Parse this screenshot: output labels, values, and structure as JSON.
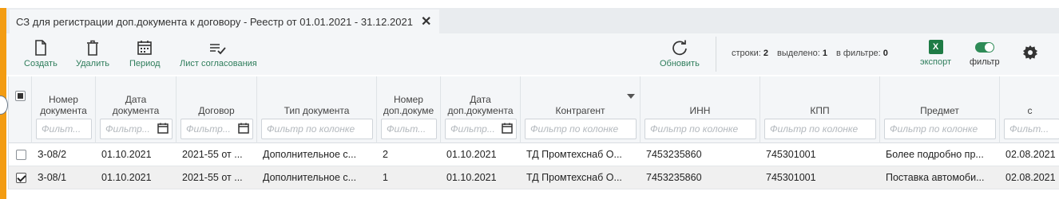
{
  "tab": {
    "title": "СЗ для регистрации доп.документа к договору - Реестр от 01.01.2021 - 31.12.2021"
  },
  "toolbar": {
    "create": "Создать",
    "delete": "Удалить",
    "period": "Период",
    "approval_sheet": "Лист согласования",
    "refresh": "Обновить",
    "export": "экспорт",
    "filter": "фильтр",
    "export_icon_letter": "X"
  },
  "stats": {
    "rows_label": "строки:",
    "rows": "2",
    "selected_label": "выделено:",
    "selected": "1",
    "in_filter_label": "в фильтре:",
    "in_filter": "0"
  },
  "columns": [
    {
      "title": "Номер\nдокумента",
      "filter": "Фильт..."
    },
    {
      "title": "Дата\nдокумента",
      "filter": "Фильтр..."
    },
    {
      "title": "Договор",
      "filter": "Фильтр..."
    },
    {
      "title": "Тип документа",
      "filter": "Фильтр по колонке"
    },
    {
      "title": "Номер\nдоп.докуме",
      "filter": "Фильт..."
    },
    {
      "title": "Дата\nдоп.документа",
      "filter": "Фильтр..."
    },
    {
      "title": "Контрагент",
      "filter": "Фильтр по колонке"
    },
    {
      "title": "ИНН",
      "filter": "Фильтр по колонке"
    },
    {
      "title": "КПП",
      "filter": "Фильтр по колонке"
    },
    {
      "title": "Предмет",
      "filter": "Фильтр по колонке"
    },
    {
      "title": "с",
      "filter": "Фильт..."
    }
  ],
  "rows": [
    {
      "checked": false,
      "cells": [
        "З-08/2",
        "01.10.2021",
        "2021-55 от ...",
        "Дополнительное с...",
        "2",
        "01.10.2021",
        "ТД Промтехснаб О...",
        "7453235860",
        "745301001",
        "Более подробно пр...",
        "02.08.2021"
      ]
    },
    {
      "checked": true,
      "cells": [
        "З-08/1",
        "01.10.2021",
        "2021-55 от ...",
        "Дополнительное с...",
        "1",
        "01.10.2021",
        "ТД Промтехснаб О...",
        "7453235860",
        "745301001",
        "Поставка автомоби...",
        "02.08.2021"
      ]
    }
  ],
  "colors": {
    "accent_green": "#2e7d5b",
    "orange": "#f39c12"
  }
}
